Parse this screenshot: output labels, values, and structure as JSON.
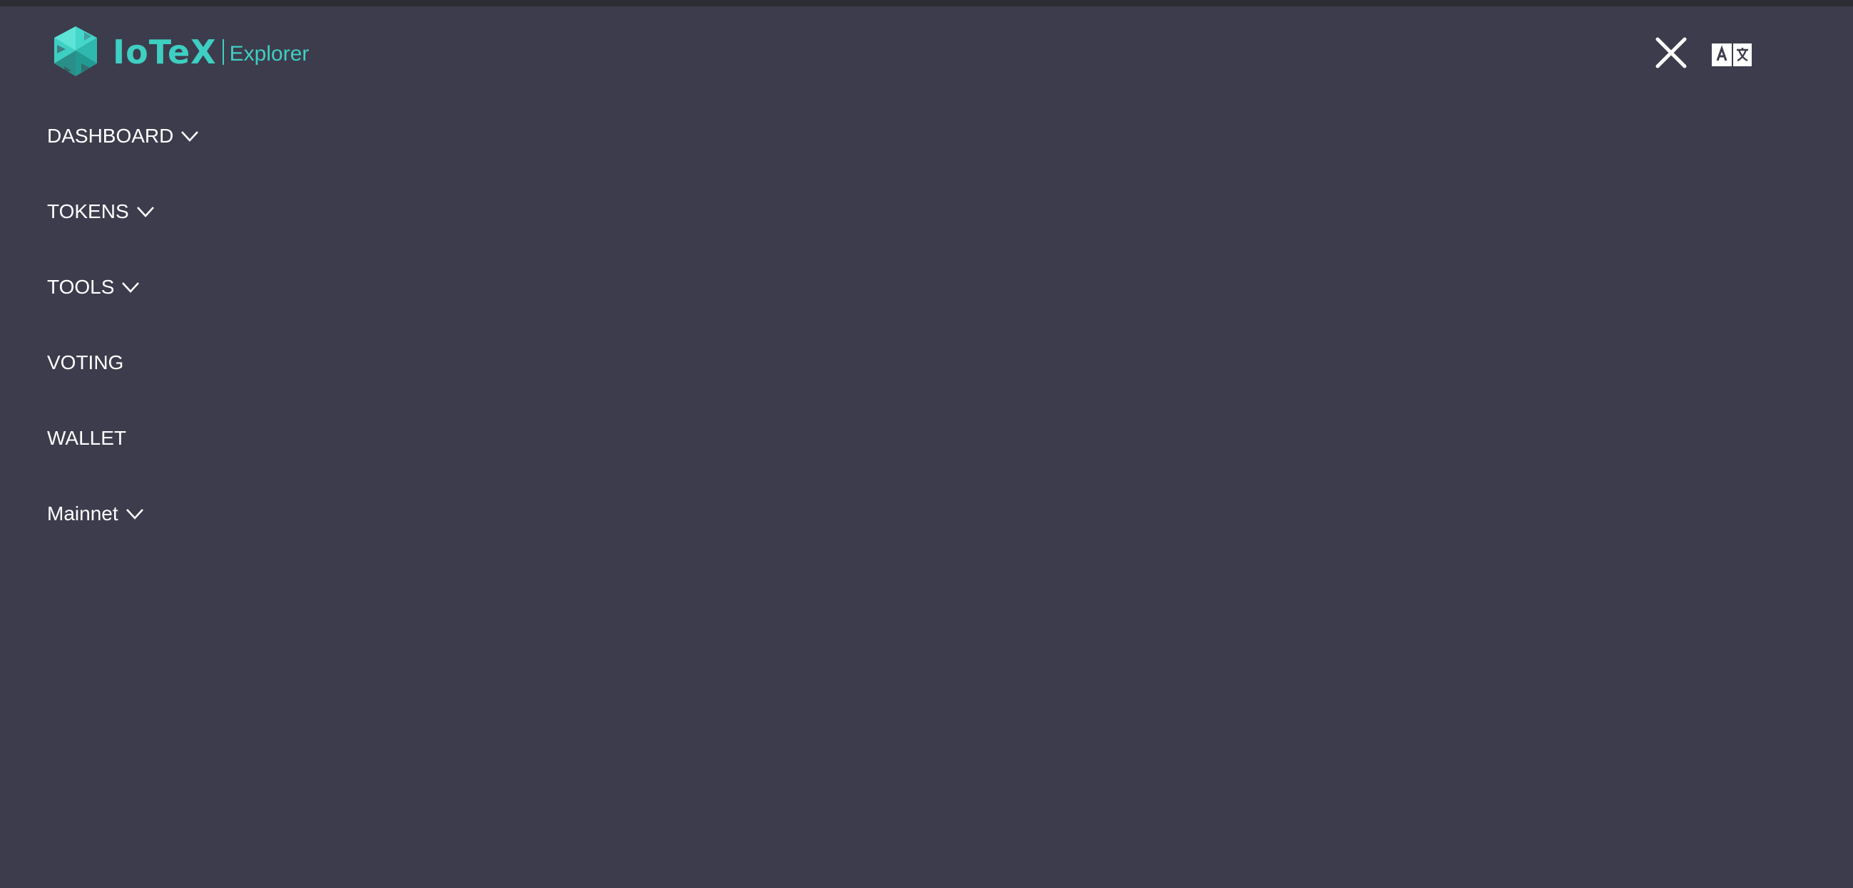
{
  "brand": {
    "name": "IoTeX",
    "subtitle": "Explorer",
    "color": "#3ecfc3"
  },
  "colors": {
    "background": "#3d3c4c",
    "text": "#ffffff",
    "accent": "#3ecfc3"
  },
  "header": {
    "close_icon": "close-icon",
    "language_icon": "translate-icon"
  },
  "menu": {
    "items": [
      {
        "label": "DASHBOARD",
        "has_dropdown": true
      },
      {
        "label": "TOKENS",
        "has_dropdown": true
      },
      {
        "label": "TOOLS",
        "has_dropdown": true
      },
      {
        "label": "VOTING",
        "has_dropdown": false
      },
      {
        "label": "WALLET",
        "has_dropdown": false
      },
      {
        "label": "Mainnet",
        "has_dropdown": true
      }
    ]
  }
}
